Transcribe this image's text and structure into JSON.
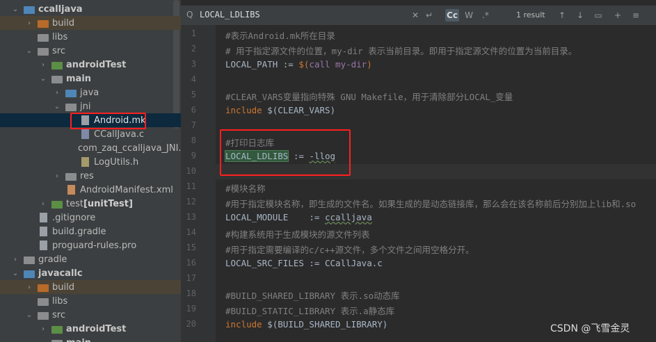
{
  "project_tree": {
    "items": [
      {
        "label": "ccalljava",
        "type": "module",
        "expanded": true
      },
      {
        "label": "build",
        "type": "folder-orange",
        "expanded": false
      },
      {
        "label": "libs",
        "type": "folder"
      },
      {
        "label": "src",
        "type": "folder",
        "expanded": true
      },
      {
        "label": "androidTest",
        "type": "folder-test",
        "expanded": false
      },
      {
        "label": "main",
        "type": "folder",
        "expanded": true
      },
      {
        "label": "java",
        "type": "folder-blue",
        "expanded": false
      },
      {
        "label": "jni",
        "type": "folder",
        "expanded": true
      },
      {
        "label": "Android.mk",
        "type": "file"
      },
      {
        "label": "CCallJava.c",
        "type": "file-c"
      },
      {
        "label": "com_zaq_ccalljava_JNI.",
        "type": "file-h"
      },
      {
        "label": "LogUtils.h",
        "type": "file-h"
      },
      {
        "label": "res",
        "type": "folder",
        "expanded": false
      },
      {
        "label": "AndroidManifest.xml",
        "type": "file-xml"
      },
      {
        "label": "test",
        "suffix": "[unitTest]",
        "type": "folder-test",
        "expanded": false
      },
      {
        "label": ".gitignore",
        "type": "file"
      },
      {
        "label": "build.gradle",
        "type": "file"
      },
      {
        "label": "proguard-rules.pro",
        "type": "file"
      },
      {
        "label": "gradle",
        "type": "folder",
        "expanded": false
      },
      {
        "label": "javacallc",
        "type": "module",
        "expanded": true
      },
      {
        "label": "build",
        "type": "folder-orange",
        "expanded": false
      },
      {
        "label": "libs",
        "type": "folder"
      },
      {
        "label": "src",
        "type": "folder",
        "expanded": true
      },
      {
        "label": "androidTest",
        "type": "folder-test",
        "expanded": false
      },
      {
        "label": "main",
        "type": "folder",
        "expanded": true
      }
    ]
  },
  "search": {
    "query": "LOCAL_LDLIBS",
    "match_case": "Cc",
    "words": "W",
    "regex": ".*",
    "result": "1 result"
  },
  "editor": {
    "lines": [
      {
        "n": "1",
        "text": "#表示Android.mk所在目录"
      },
      {
        "n": "2",
        "text": "# 用于指定源文件的位置，my-dir 表示当前目录。即用于指定源文件的位置为当前目录。"
      },
      {
        "n": "3",
        "text": "LOCAL_PATH := $(call my-dir)"
      },
      {
        "n": "4",
        "text": ""
      },
      {
        "n": "5",
        "text": "#CLEAR_VARS变量指向特殊 GNU Makefile，用于清除部分LOCAL_变量"
      },
      {
        "n": "6",
        "text": "include $(CLEAR_VARS)"
      },
      {
        "n": "7",
        "text": ""
      },
      {
        "n": "8",
        "text": "#打印日志库"
      },
      {
        "n": "9",
        "text": "LOCAL_LDLIBS := -llog"
      },
      {
        "n": "10",
        "text": ""
      },
      {
        "n": "11",
        "text": "#模块名称"
      },
      {
        "n": "12",
        "text": "#用于指定模块名称，即生成的文件名。如果生成的是动态链接库，那么会在该名称前后分别加上lib和.so"
      },
      {
        "n": "13",
        "text": "LOCAL_MODULE    := ccalljava"
      },
      {
        "n": "14",
        "text": "#构建系统用于生成模块的源文件列表"
      },
      {
        "n": "15",
        "text": "#用于指定需要编译的c/c++源文件，多个文件之间用空格分开。"
      },
      {
        "n": "16",
        "text": "LOCAL_SRC_FILES := CCallJava.c"
      },
      {
        "n": "17",
        "text": ""
      },
      {
        "n": "18",
        "text": "#BUILD_SHARED_LIBRARY 表示.so动态库"
      },
      {
        "n": "19",
        "text": "#BUILD_STATIC_LIBRARY 表示.a静态库"
      },
      {
        "n": "20",
        "text": "include $(BUILD_SHARED_LIBRARY)"
      }
    ]
  },
  "watermark": "CSDN @飞雪金灵",
  "colors": {
    "highlight_box": "#ff1f1f",
    "accent": "#4e5a64"
  }
}
